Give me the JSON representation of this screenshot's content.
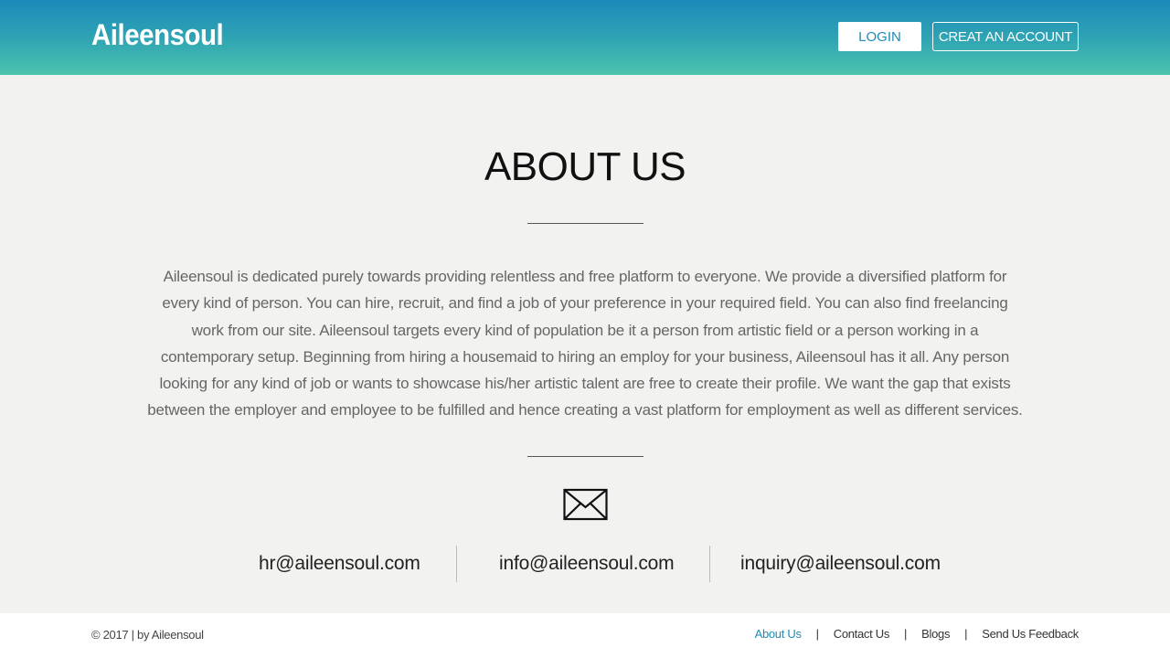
{
  "header": {
    "logo": "Aileensoul",
    "login_label": "LOGIN",
    "create_account_label": "CREAT AN ACCOUNT"
  },
  "main": {
    "title": "ABOUT US",
    "description": "Aileensoul is dedicated purely towards providing relentless and free platform to everyone. We provide a diversified platform for every kind of person. You can hire, recruit, and find a job of your preference in your required field. You can also find freelancing work from our site. Aileensoul targets every kind of population be it a person from artistic field or a person working in a contemporary setup. Beginning from hiring a housemaid to hiring an employ for your business, Aileensoul has it all. Any person looking for any kind of job or wants to showcase his/her artistic talent are free to create their profile. We want the gap that exists between the employer and employee to be fulfilled and hence creating a vast platform for employment as well as different services.",
    "contact_icon": "envelope-icon",
    "emails": [
      "hr@aileensoul.com",
      "info@aileensoul.com",
      "inquiry@aileensoul.com"
    ]
  },
  "footer": {
    "copyright": "© 2017 | by Aileensoul",
    "links": [
      "About Us",
      "Contact Us",
      "Blogs",
      "Send Us Feedback"
    ],
    "separator": "|"
  },
  "colors": {
    "header_gradient_top": "#1c8ab9",
    "header_gradient_bottom": "#4cc4ae",
    "accent": "#1e8bb8",
    "page_background": "#f2f2f0"
  }
}
